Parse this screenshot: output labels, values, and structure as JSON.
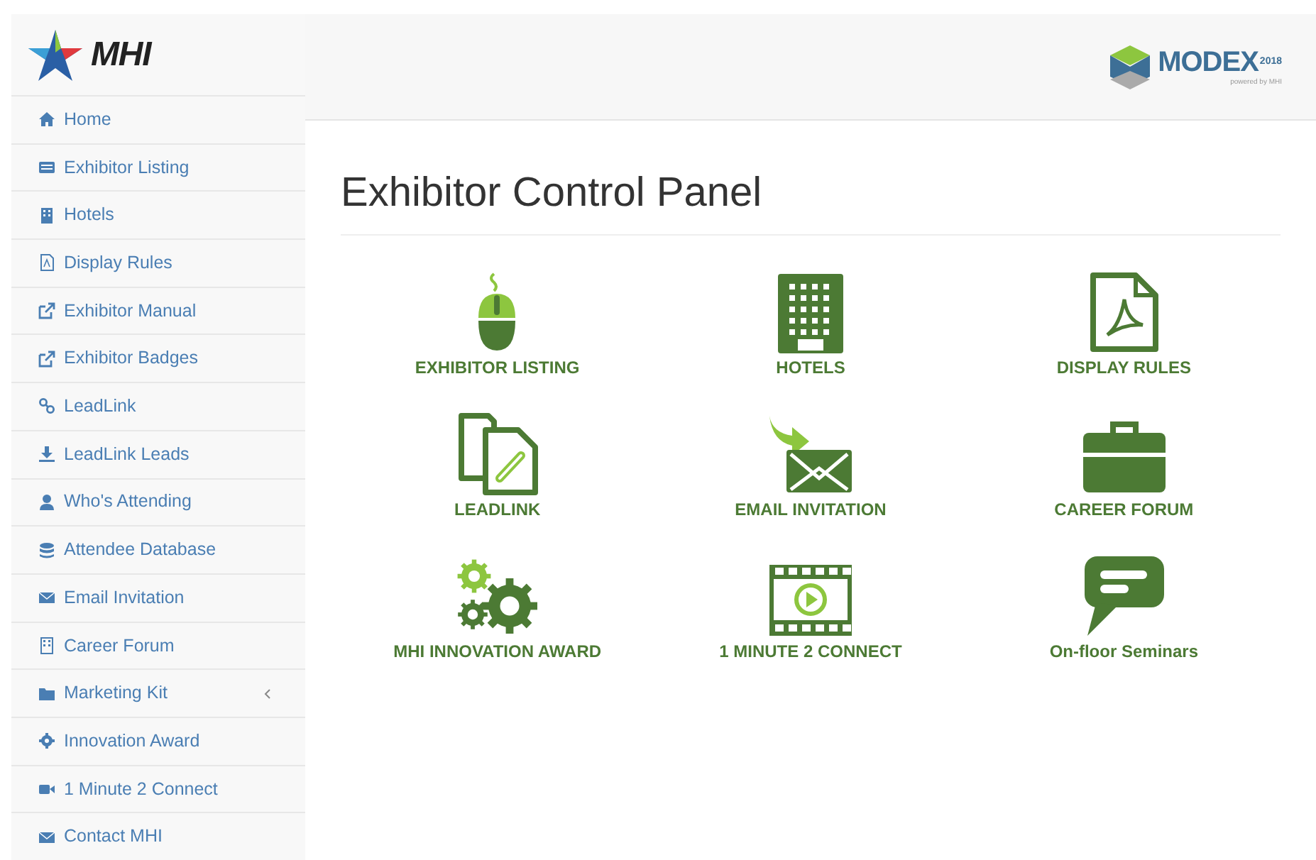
{
  "logo": {
    "text": "MHI"
  },
  "brand": {
    "name": "MODEX",
    "year": "2018",
    "tagline": "powered by MHI"
  },
  "sidebar": {
    "items": [
      {
        "label": "Home",
        "has_submenu": false
      },
      {
        "label": "Exhibitor Listing",
        "has_submenu": false
      },
      {
        "label": "Hotels",
        "has_submenu": false
      },
      {
        "label": "Display Rules",
        "has_submenu": false
      },
      {
        "label": "Exhibitor Manual",
        "has_submenu": false
      },
      {
        "label": "Exhibitor Badges",
        "has_submenu": false
      },
      {
        "label": "LeadLink",
        "has_submenu": false
      },
      {
        "label": "LeadLink Leads",
        "has_submenu": false
      },
      {
        "label": "Who's Attending",
        "has_submenu": false
      },
      {
        "label": "Attendee Database",
        "has_submenu": false
      },
      {
        "label": "Email Invitation",
        "has_submenu": false
      },
      {
        "label": "Career Forum",
        "has_submenu": false
      },
      {
        "label": "Marketing Kit",
        "has_submenu": true
      },
      {
        "label": "Innovation Award",
        "has_submenu": false
      },
      {
        "label": "1 Minute 2 Connect",
        "has_submenu": false
      },
      {
        "label": "Contact MHI",
        "has_submenu": false
      }
    ]
  },
  "page": {
    "title": "Exhibitor Control Panel",
    "tiles": [
      {
        "label": "EXHIBITOR LISTING"
      },
      {
        "label": "HOTELS"
      },
      {
        "label": "DISPLAY RULES"
      },
      {
        "label": "LEADLINK"
      },
      {
        "label": "EMAIL INVITATION"
      },
      {
        "label": "CAREER FORUM"
      },
      {
        "label": "MHI INNOVATION AWARD"
      },
      {
        "label": "1 MINUTE 2 CONNECT"
      },
      {
        "label": "On-floor Seminars"
      }
    ]
  }
}
